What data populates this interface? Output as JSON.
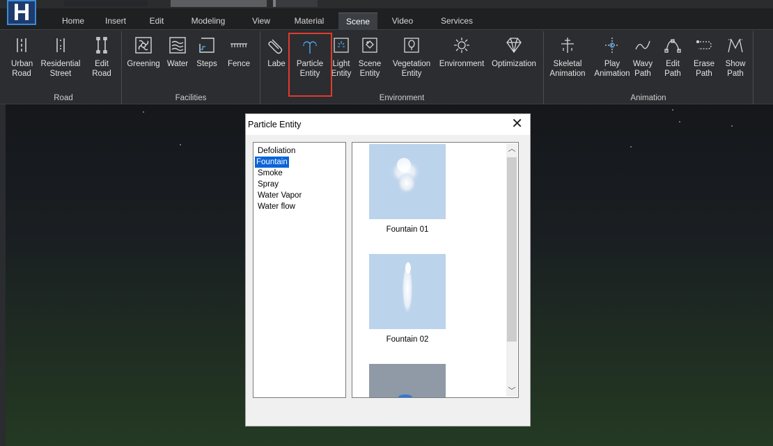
{
  "app": {
    "logo_letter": "H"
  },
  "tabs": [
    {
      "label": "Home"
    },
    {
      "label": "Insert"
    },
    {
      "label": "Edit"
    },
    {
      "label": "Modeling"
    },
    {
      "label": "View"
    },
    {
      "label": "Material"
    },
    {
      "label": "Scene",
      "active": true
    },
    {
      "label": "Video"
    },
    {
      "label": "Services"
    }
  ],
  "ribbon": {
    "road": {
      "label": "Road",
      "buttons": [
        {
          "label": "Urban\nRoad",
          "icon": "urban-road-icon"
        },
        {
          "label": "Residential\nStreet",
          "icon": "residential-street-icon"
        },
        {
          "label": "Edit\nRoad",
          "icon": "edit-road-icon"
        }
      ]
    },
    "facilities": {
      "label": "Facilities",
      "buttons": [
        {
          "label": "Greening",
          "icon": "greening-icon"
        },
        {
          "label": "Water",
          "icon": "water-icon"
        },
        {
          "label": "Steps",
          "icon": "steps-icon"
        },
        {
          "label": "Fence",
          "icon": "fence-icon"
        }
      ]
    },
    "environment": {
      "label": "Environment",
      "buttons": [
        {
          "label": "Labe",
          "icon": "label-icon"
        },
        {
          "label": "Particle\nEntity",
          "icon": "particle-entity-icon"
        },
        {
          "label": "Light\nEntity",
          "icon": "light-entity-icon"
        },
        {
          "label": "Scene\nEntity",
          "icon": "scene-entity-icon"
        },
        {
          "label": "Vegetation\nEntity",
          "icon": "vegetation-entity-icon"
        },
        {
          "label": "Environment",
          "icon": "environment-icon"
        },
        {
          "label": "Optimization",
          "icon": "optimization-icon"
        }
      ]
    },
    "animation": {
      "label": "Animation",
      "buttons": [
        {
          "label": "Skeletal\nAnimation",
          "icon": "skeletal-animation-icon"
        },
        {
          "label": "Play\nAnimation",
          "icon": "play-animation-icon"
        },
        {
          "label": "Wavy\nPath",
          "icon": "wavy-path-icon"
        },
        {
          "label": "Edit\nPath",
          "icon": "edit-path-icon"
        },
        {
          "label": "Erase\nPath",
          "icon": "erase-path-icon"
        },
        {
          "label": "Show\nPath",
          "icon": "show-path-icon"
        }
      ]
    }
  },
  "dialog": {
    "title": "Particle Entity",
    "close_glyph": "✕",
    "categories": [
      "Defoliation",
      "Fountain",
      "Smoke",
      "Spray",
      "Water Vapor",
      "Water flow"
    ],
    "selected_category": "Fountain",
    "thumbnails": [
      {
        "caption": "Fountain 01"
      },
      {
        "caption": "Fountain 02"
      },
      {
        "caption": ""
      }
    ]
  }
}
